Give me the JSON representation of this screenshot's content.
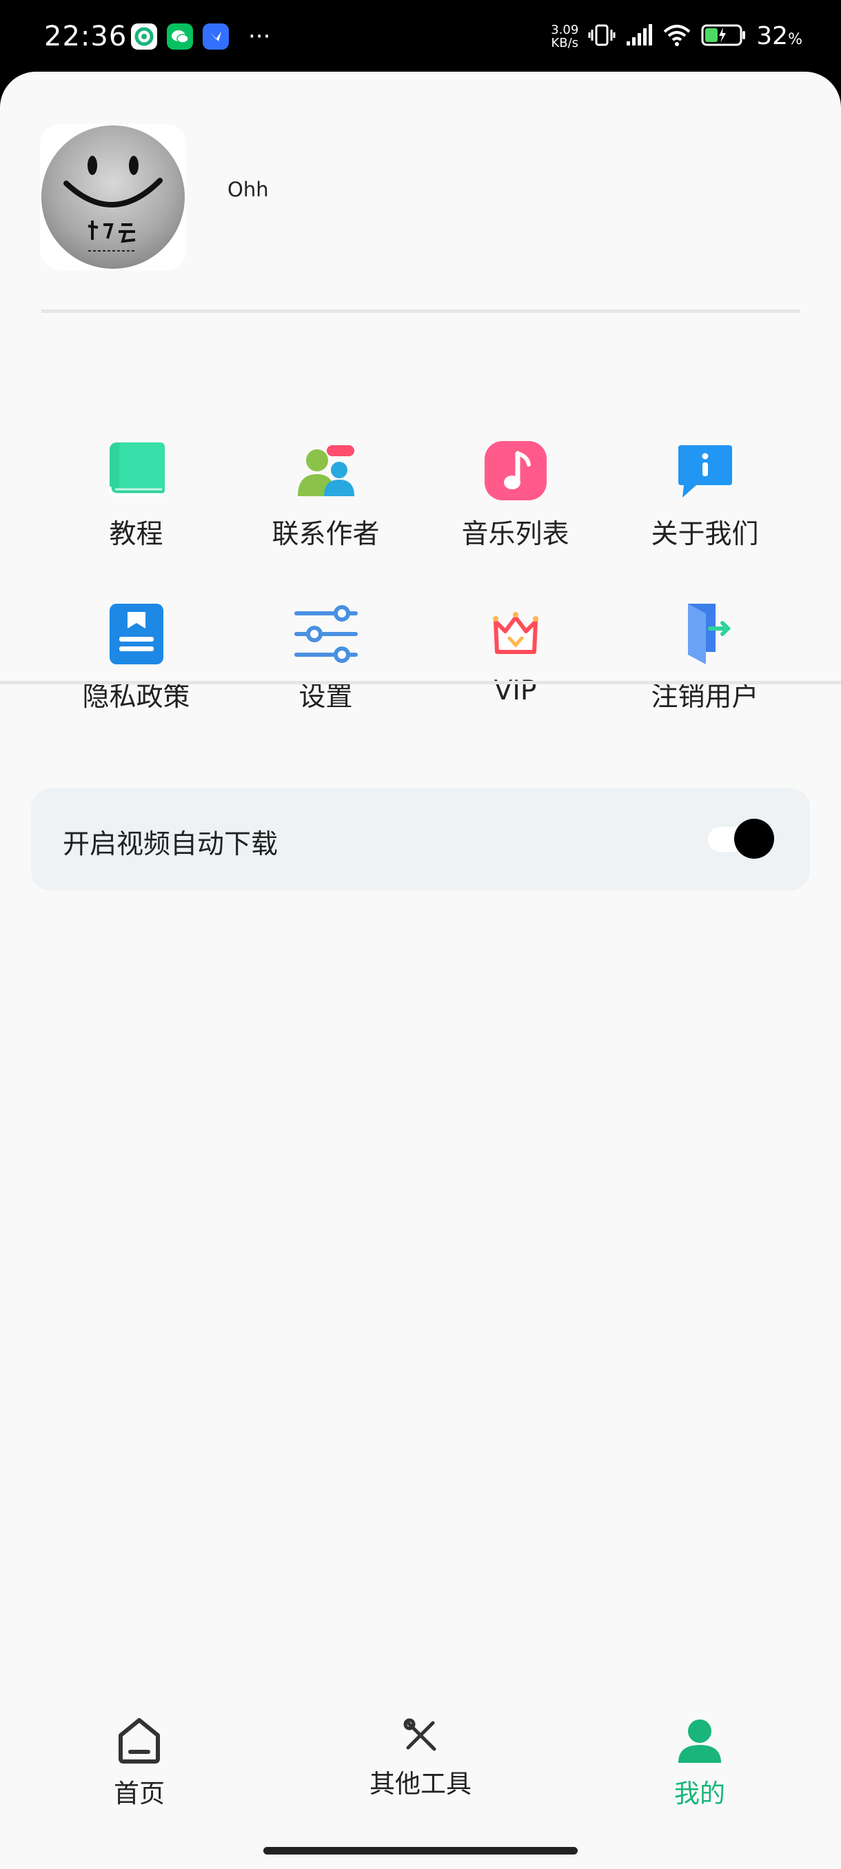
{
  "status_bar": {
    "time": "22:36",
    "net_speed_value": "3.09",
    "net_speed_unit": "KB/s",
    "battery_percent": "32",
    "battery_percent_suffix": "%",
    "icons": [
      "app-icon-1",
      "wechat-icon",
      "feishu-icon",
      "more-dots-icon",
      "vibrate-icon",
      "signal-icon",
      "wifi-icon",
      "battery-icon"
    ]
  },
  "profile": {
    "username": "Ohh"
  },
  "menu": {
    "items": [
      {
        "label": "教程",
        "icon": "book-icon",
        "color": "#2fd39b"
      },
      {
        "label": "联系作者",
        "icon": "contacts-icon",
        "color": "#8bc34a"
      },
      {
        "label": "音乐列表",
        "icon": "music-note-icon",
        "color": "#ff5a8a"
      },
      {
        "label": "关于我们",
        "icon": "info-chat-icon",
        "color": "#2196f3"
      },
      {
        "label": "隐私政策",
        "icon": "privacy-doc-icon",
        "color": "#1e88e5"
      },
      {
        "label": "设置",
        "icon": "sliders-icon",
        "color": "#4a90e2"
      },
      {
        "label": "VIP",
        "icon": "crown-icon",
        "color": "#ff4d5a"
      },
      {
        "label": "注销用户",
        "icon": "logout-door-icon",
        "color": "#3d7eea"
      }
    ]
  },
  "settings": {
    "auto_download_label": "开启视频自动下载",
    "auto_download_enabled": true
  },
  "bottom_nav": {
    "items": [
      {
        "label": "首页",
        "icon": "home-icon",
        "active": false
      },
      {
        "label": "其他工具",
        "icon": "tools-icon",
        "active": false
      },
      {
        "label": "我的",
        "icon": "user-icon",
        "active": true
      }
    ],
    "active_color": "#19b57a"
  }
}
